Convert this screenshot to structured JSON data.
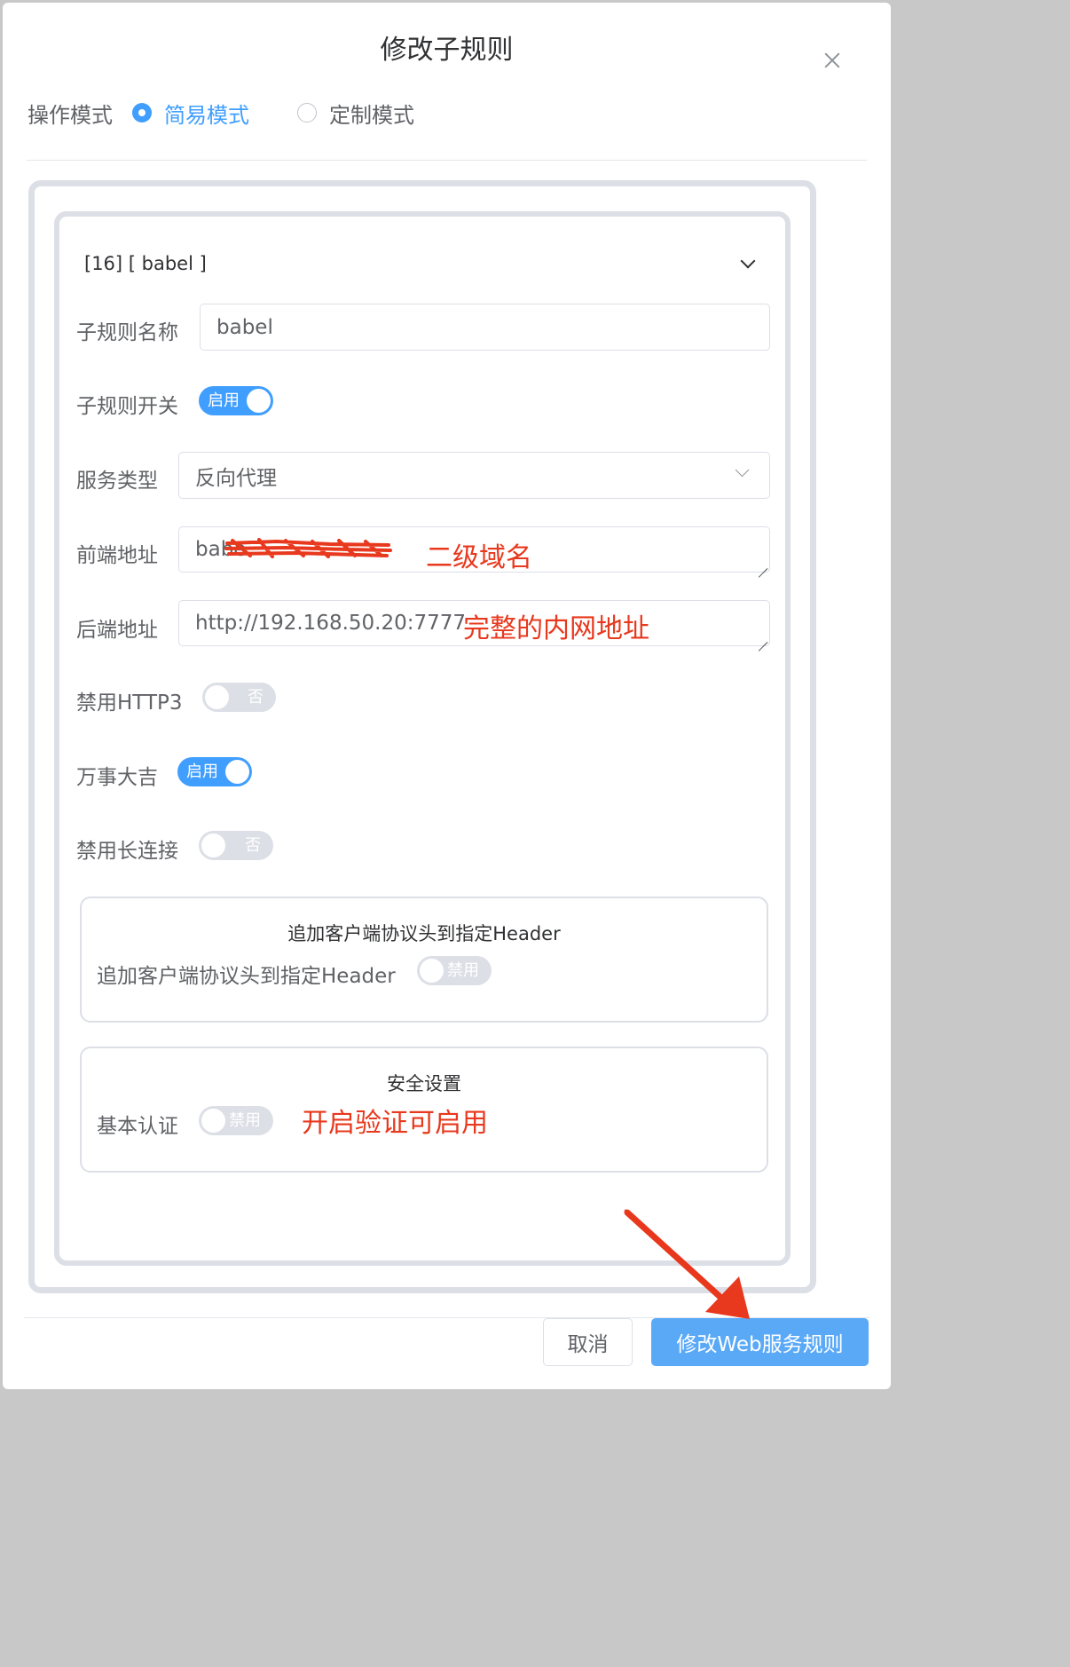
{
  "dialog": {
    "title": "修改子规则"
  },
  "mode": {
    "label": "操作模式",
    "options": [
      {
        "label": "简易模式",
        "checked": true
      },
      {
        "label": "定制模式",
        "checked": false
      }
    ]
  },
  "rule": {
    "collapse_title": "[16] [ babel ]",
    "fields": {
      "name": {
        "label": "子规则名称",
        "value": "babel"
      },
      "enabled": {
        "label": "子规则开关",
        "state": "启用"
      },
      "service_type": {
        "label": "服务类型",
        "value": "反向代理"
      },
      "frontend": {
        "label": "前端地址",
        "value": "babe"
      },
      "backend": {
        "label": "后端地址",
        "value": "http://192.168.50.20:7777"
      },
      "disable_http3": {
        "label": "禁用HTTP3",
        "state": "否"
      },
      "wanshi": {
        "label": "万事大吉",
        "state": "启用"
      },
      "disable_keepalive": {
        "label": "禁用长连接",
        "state": "否"
      }
    },
    "groups": {
      "header": {
        "title": "追加客户端协议头到指定Header",
        "field_label": "追加客户端协议头到指定Header",
        "state": "禁用"
      },
      "security": {
        "title": "安全设置",
        "field_label": "基本认证",
        "state": "禁用"
      }
    }
  },
  "annotations": {
    "frontend_note": "二级域名",
    "backend_note": "完整的内网地址",
    "auth_note": "开启验证可启用"
  },
  "footer": {
    "cancel_label": "取消",
    "submit_label": "修改Web服务规则"
  },
  "colors": {
    "primary": "#409eff",
    "annotation_red": "#e8381d",
    "border": "#dcdfe6"
  }
}
